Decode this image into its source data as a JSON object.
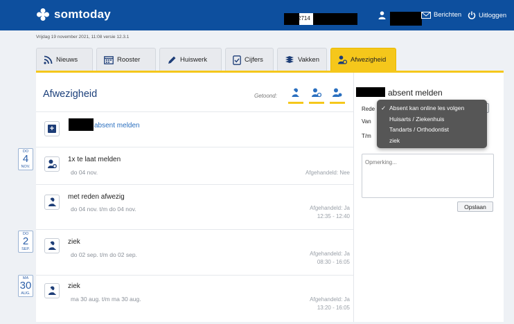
{
  "header": {
    "brand": "somtoday",
    "student_id_fragment": "2714",
    "messages_label": "Berichten",
    "logout_label": "Uitloggen"
  },
  "version_line": "Vrijdag 19 november 2021, 11:08 versie 12.3.1",
  "tabs": [
    {
      "label": "Nieuws",
      "icon": "rss-icon",
      "active": false
    },
    {
      "label": "Rooster",
      "icon": "calendar-icon",
      "active": false
    },
    {
      "label": "Huiswerk",
      "icon": "pencil-icon",
      "active": false
    },
    {
      "label": "Cijfers",
      "icon": "checklist-icon",
      "active": false
    },
    {
      "label": "Vakken",
      "icon": "books-icon",
      "active": false
    },
    {
      "label": "Afwezigheid",
      "icon": "person-icon",
      "active": true
    }
  ],
  "main": {
    "title": "Afwezigheid",
    "shown_label": "Getoond:",
    "add_label": "absent melden"
  },
  "entries": [
    {
      "title": "1x te laat melden",
      "sub": "do 04 nov.",
      "status": [
        "Afgehandeld: Nee"
      ],
      "icon": "late-person-icon"
    },
    {
      "title": "met reden afwezig",
      "sub": "do 04 nov. t/m do 04 nov.",
      "status": [
        "Afgehandeld: Ja",
        "12:35 - 12:40"
      ],
      "icon": "absent-person-icon"
    },
    {
      "title": "ziek",
      "sub": "do 02 sep. t/m do 02 sep.",
      "status": [
        "Afgehandeld: Ja",
        "08:30 - 16:05"
      ],
      "icon": "absent-person-icon"
    },
    {
      "title": "ziek",
      "sub": "ma 30 aug. t/m ma 30 aug.",
      "status": [
        "Afgehandeld: Ja",
        "13:20 - 16:05"
      ],
      "icon": "absent-person-icon"
    }
  ],
  "date_badges": [
    {
      "day": "DO",
      "num": "4",
      "month": "NOV."
    },
    {
      "day": "DO",
      "num": "2",
      "month": "SEP."
    },
    {
      "day": "MA",
      "num": "30",
      "month": "AUG."
    }
  ],
  "form": {
    "title": "absent melden",
    "reason_label_fragment": "Rede",
    "from_label_fragment": "Van",
    "until_label_fragment": "T/m",
    "remark_placeholder": "Opmerking...",
    "save_label": "Opslaan"
  },
  "dropdown": {
    "options": [
      "Absent kan online les volgen",
      "Huisarts / Ziekenhuis",
      "Tandarts / Orthodontist",
      "ziek"
    ],
    "selected": "Absent kan online les volgen",
    "check_glyph": "✓"
  },
  "colors": {
    "header": "#0d4f9e",
    "accent_yellow": "#f5c71b",
    "title_blue": "#1b3f7a",
    "link_blue": "#2a6fbf",
    "dropdown_bg": "#565656"
  }
}
